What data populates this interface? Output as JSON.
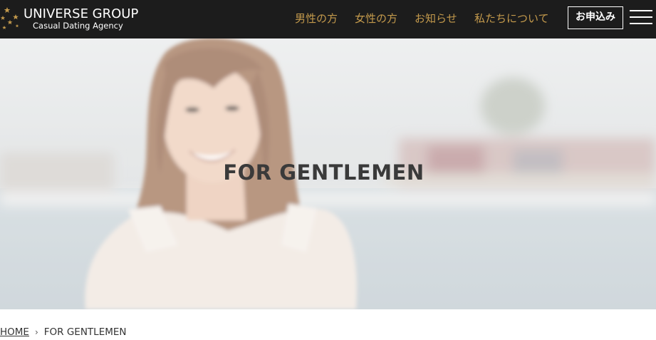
{
  "brand": {
    "title": "UNIVERSE GROUP",
    "subtitle": "Casual Dating Agency"
  },
  "nav": {
    "items": [
      {
        "label": "男性の方"
      },
      {
        "label": "女性の方"
      },
      {
        "label": "お知らせ"
      },
      {
        "label": "私たちについて"
      }
    ],
    "apply_label": "お申込み"
  },
  "hero": {
    "title": "FOR GENTLEMEN"
  },
  "breadcrumb": {
    "home": "HOME",
    "separator": "›",
    "current": "FOR GENTLEMEN"
  },
  "colors": {
    "header_bg": "#1c1c1c",
    "nav_accent": "#c49a4c",
    "hero_title": "#3a3a3a"
  },
  "icons": {
    "logo": "stars-icon",
    "menu": "hamburger-menu-icon",
    "breadcrumb_separator": "chevron-right-icon"
  }
}
